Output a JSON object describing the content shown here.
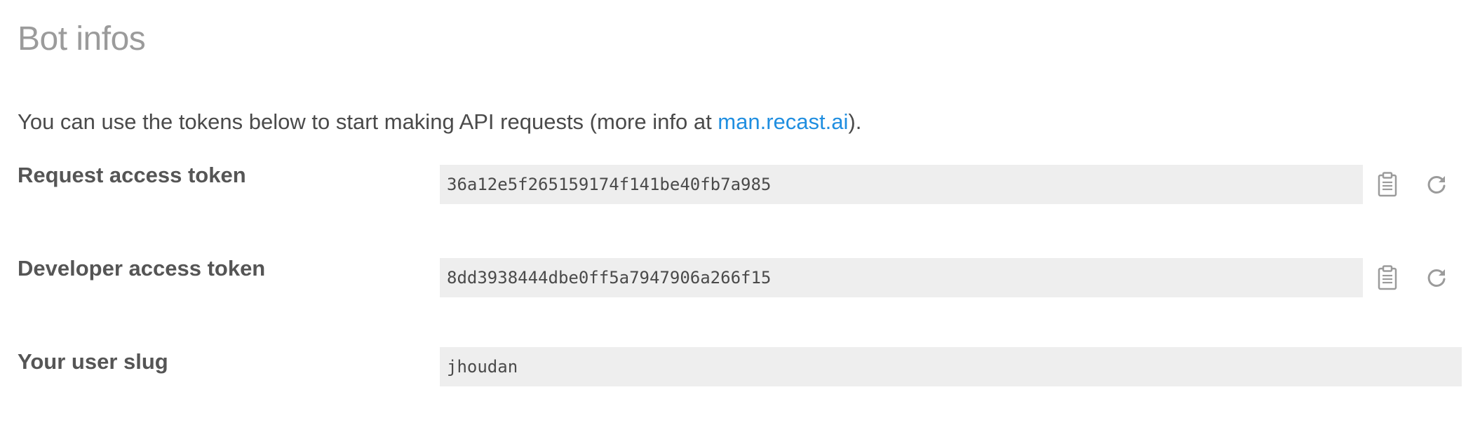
{
  "header": {
    "title": "Bot infos"
  },
  "intro": {
    "text_before": "You can use the tokens below to start making API requests (more info at ",
    "link_text": "man.recast.ai",
    "text_after": ")."
  },
  "tokens": {
    "request": {
      "label": "Request access token",
      "value": "36a12e5f265159174f141be40fb7a985"
    },
    "developer": {
      "label": "Developer access token",
      "value": "8dd3938444dbe0ff5a7947906a266f15"
    },
    "slug": {
      "label": "Your user slug",
      "value": "jhoudan"
    }
  },
  "icons": {
    "copy": "clipboard-icon",
    "refresh": "refresh-icon",
    "color": "#9b9b9b"
  }
}
